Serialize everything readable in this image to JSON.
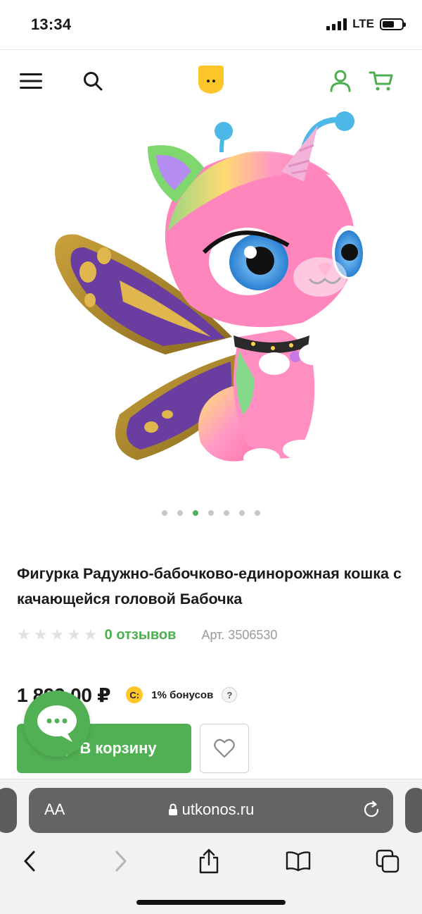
{
  "status_bar": {
    "time": "13:34",
    "network": "LTE",
    "battery_level": 0.6
  },
  "header": {
    "menu_icon": "hamburger-icon",
    "search_icon": "search-icon",
    "logo_text": "..",
    "user_icon": "user-icon",
    "cart_icon": "cart-icon",
    "accent_color": "#4caf50",
    "logo_color": "#ffc629"
  },
  "gallery": {
    "image_alt": "rainbow butterfly unicorn kitty figure",
    "dot_count": 7,
    "active_dot": 2
  },
  "product": {
    "title": "Фигурка Радужно-бабочково-единорожная кошка с качающейся головой Бабочка",
    "rating": 0,
    "rating_max": 5,
    "reviews_label": "0 отзывов",
    "article_label": "Арт. 3506530",
    "price": "1 899,00 ₽",
    "bonus_badge": "С:",
    "bonus_label": "1% бонусов",
    "help_label": "?",
    "add_to_cart_label": "В корзину",
    "favorite_icon": "heart-icon",
    "chat_icon": "chat-bubble-icon"
  },
  "browser": {
    "aa_label": "AA",
    "url": "utkonos.ru",
    "reload_icon": "reload-icon",
    "nav": [
      "back-icon",
      "forward-icon",
      "share-icon",
      "bookmarks-icon",
      "tabs-icon"
    ]
  }
}
